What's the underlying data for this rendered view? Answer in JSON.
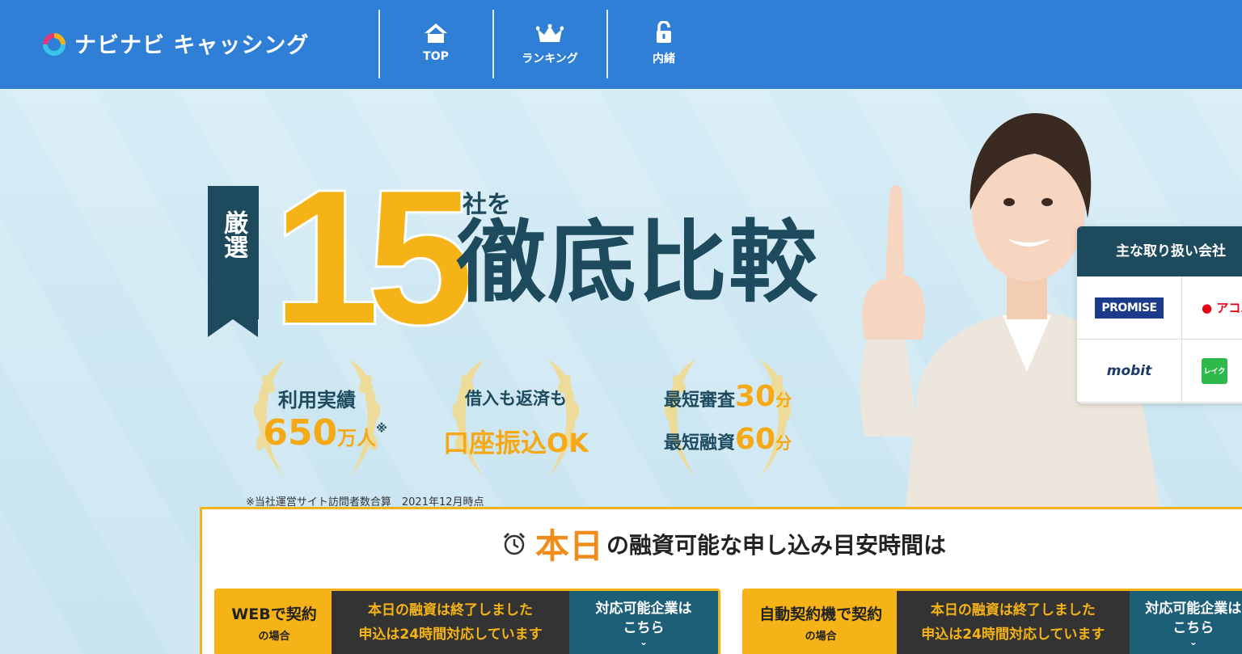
{
  "header": {
    "logo_text": "ナビナビ キャッシング",
    "nav": [
      {
        "label": "TOP",
        "icon": "home-icon"
      },
      {
        "label": "ランキング",
        "icon": "crown-icon"
      },
      {
        "label": "内緒",
        "icon": "lock-icon"
      }
    ]
  },
  "hero": {
    "ribbon_text": "厳選",
    "count": "15",
    "count_suffix": "社を",
    "headline": "徹底比較",
    "awards": [
      {
        "line1": "利用実績",
        "line2": "650",
        "line2_unit": "万人",
        "mark": "※"
      },
      {
        "line1": "借入も返済も",
        "line2": "口座振込OK"
      },
      {
        "row1_label": "最短審査",
        "row1_num": "30",
        "row1_unit": "分",
        "row2_label": "最短融資",
        "row2_num": "60",
        "row2_unit": "分"
      }
    ],
    "footnote": "※当社運営サイト訪問者数合算　2021年12月時点"
  },
  "companies": {
    "title": "主な取り扱い会社",
    "logos": [
      "PROMISE",
      "アコム",
      "mobit",
      "レイク"
    ]
  },
  "time_box": {
    "title_today": "本日",
    "title_rest": "の融資可能な申し込み目安時間は",
    "contracts": [
      {
        "main": "WEBで契約",
        "sub": "の場合",
        "status1": "本日の融資は終了しました",
        "status2": "申込は24時間対応しています",
        "cta1": "対応可能企業は",
        "cta2": "こちら"
      },
      {
        "main": "自動契約機で契約",
        "sub": "の場合",
        "status1": "本日の融資は終了しました",
        "status2": "申込は24時間対応しています",
        "cta1": "対応可能企業は",
        "cta2": "こちら"
      }
    ]
  },
  "colors": {
    "header_blue": "#2f7fd6",
    "accent_yellow": "#f5b317",
    "navy": "#1d4a5c",
    "orange": "#f08c1a"
  }
}
